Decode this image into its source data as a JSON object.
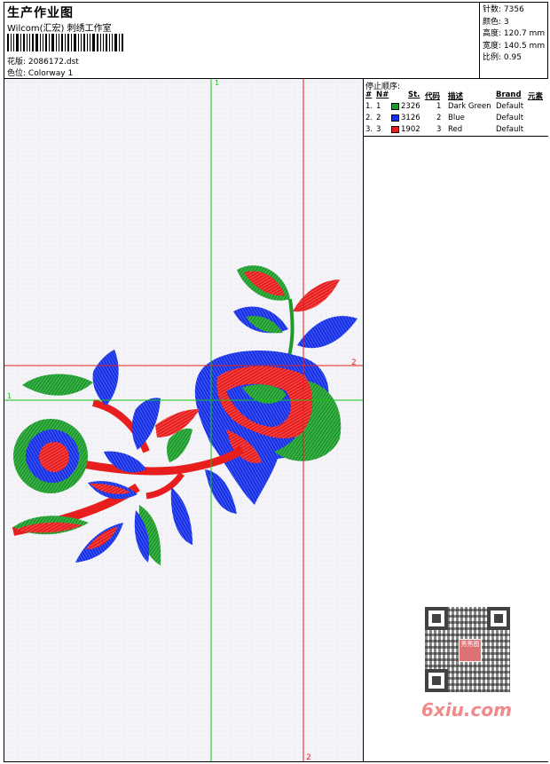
{
  "header": {
    "title": "生产作业图",
    "subtitle": "Wilcom(汇宏) 刺绣工作室",
    "design_label": "花版:",
    "design_file": "2086172.dst",
    "colorway_label": "色位:",
    "colorway": "Colorway 1"
  },
  "stats": {
    "stitches_label": "针数:",
    "stitches": "7356",
    "colors_label": "颜色:",
    "colors": "3",
    "height_label": "高度:",
    "height": "120.7 mm",
    "width_label": "宽度:",
    "width": "140.5 mm",
    "scale_label": "比例:",
    "scale": "0.95"
  },
  "stop_sequence": {
    "label": "停止顺序:",
    "headers": {
      "num": "#",
      "no": "N#",
      "st": "St.",
      "code": "代码",
      "desc": "描述",
      "brand": "Brand",
      "element": "元素"
    },
    "rows": [
      {
        "num": "1.",
        "no": "1",
        "color": "#1d9a2b",
        "st": "2326",
        "code": "1",
        "desc": "Dark Green",
        "brand": "Default"
      },
      {
        "num": "2.",
        "no": "2",
        "color": "#1630e6",
        "st": "3126",
        "code": "2",
        "desc": "Blue",
        "brand": "Default"
      },
      {
        "num": "3.",
        "no": "3",
        "color": "#e81e1e",
        "st": "1902",
        "code": "3",
        "desc": "Red",
        "brand": "Default"
      }
    ]
  },
  "guides": {
    "green_marker": "1",
    "red_marker": "2",
    "green_color": "#16c416",
    "red_color": "#e22020"
  },
  "watermark": {
    "text": "6xiu.com",
    "seal": "秀秀图"
  },
  "thread_colors": {
    "green": "#1d9a2b",
    "blue": "#1630e6",
    "red": "#e81e1e"
  }
}
